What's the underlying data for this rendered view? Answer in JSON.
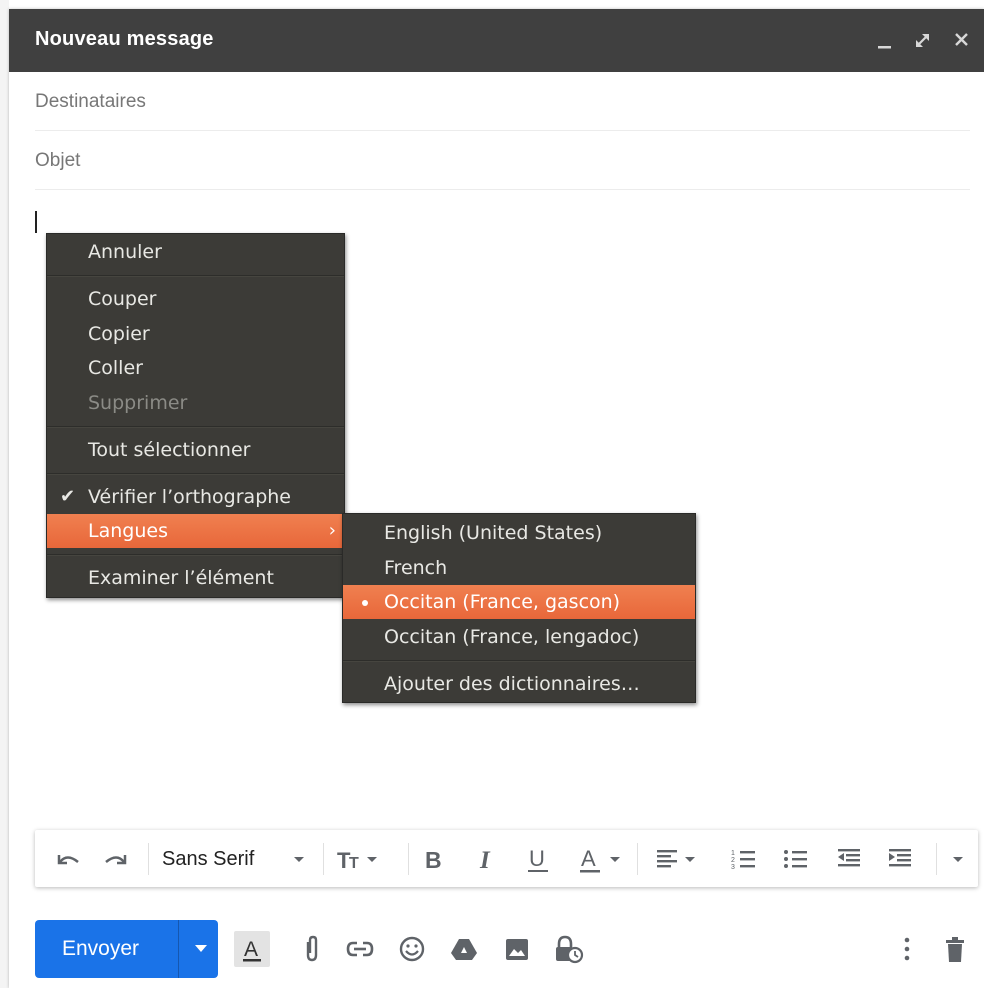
{
  "window": {
    "title": "Nouveau message",
    "controls": [
      "minimize-icon",
      "expand-icon",
      "close-icon"
    ]
  },
  "fields": {
    "recipients_placeholder": "Destinataires",
    "subject_placeholder": "Objet"
  },
  "context_menu": {
    "items": [
      {
        "label": "Annuler",
        "mnemonic": "u",
        "enabled": true
      },
      {
        "label": "Couper",
        "mnemonic": "C",
        "enabled": true
      },
      {
        "label": "Copier",
        "mnemonic": "p",
        "enabled": true
      },
      {
        "label": "Coller",
        "mnemonic": "o",
        "enabled": true
      },
      {
        "label": "Supprimer",
        "mnemonic": "S",
        "enabled": false
      },
      {
        "label": "Tout sélectionner",
        "mnemonic": "T",
        "enabled": true
      },
      {
        "label": "Vérifier l’orthographe",
        "mnemonic": "V",
        "checked": true
      },
      {
        "label": "Langues",
        "mnemonic": "g",
        "highlighted": true,
        "submenu": true
      },
      {
        "label": "Examiner l’élément",
        "mnemonic": "x",
        "enabled": true
      }
    ]
  },
  "languages_submenu": {
    "items": [
      {
        "label": "English (United States)"
      },
      {
        "label": "French"
      },
      {
        "label": "Occitan (France, gascon)",
        "selected": true
      },
      {
        "label": "Occitan (France, lengadoc)"
      },
      {
        "label": "Ajouter des dictionnaires…",
        "mnemonic": "A"
      }
    ]
  },
  "toolbar": {
    "font_name": "Sans Serif",
    "icons": [
      "undo-icon",
      "redo-icon",
      "font-size-icon",
      "bold-icon",
      "italic-icon",
      "underline-icon",
      "text-color-icon",
      "align-icon",
      "numbered-list-icon",
      "bulleted-list-icon",
      "indent-less-icon",
      "indent-more-icon",
      "more-formatting-icon"
    ]
  },
  "bottom": {
    "send_label": "Envoyer",
    "icons": [
      "formatting-options-icon",
      "attach-icon",
      "link-icon",
      "emoji-icon",
      "drive-icon",
      "photo-icon",
      "confidential-mode-icon",
      "more-options-icon",
      "discard-icon"
    ]
  },
  "colors": {
    "titlebar": "#404040",
    "menu_bg": "#3c3b37",
    "menu_highlight": "#e8673a",
    "send_button": "#1a73e8"
  }
}
